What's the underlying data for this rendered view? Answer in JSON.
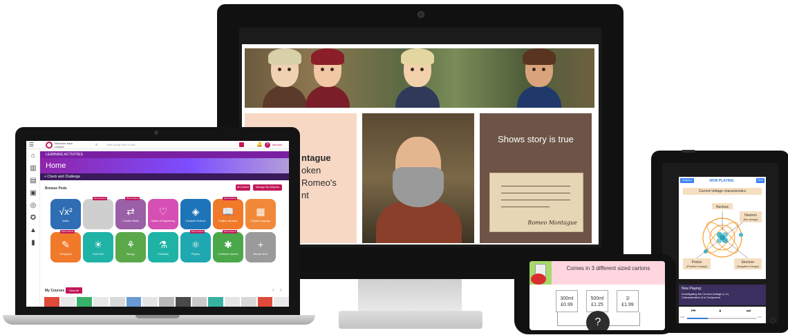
{
  "monitor": {
    "story": {
      "left_panel": {
        "name_partial": "ntague",
        "lines": [
          "oken",
          "Romeo's",
          "nt"
        ]
      },
      "right_panel": {
        "title": "Shows story is true",
        "signature": "Romeo Montague"
      }
    }
  },
  "laptop": {
    "topbar": {
      "welcome": "Welcome back",
      "welcome_sub": "Learner",
      "search_placeholder": "Start typing here to find...",
      "help": "?",
      "member": "Member"
    },
    "sidebar_icons": [
      "home-icon",
      "stats-icon",
      "notes-icon",
      "calculator-icon",
      "camera-icon",
      "award-icon",
      "grad-cap-icon",
      "chart-icon"
    ],
    "breadcrumb": "LEARNING ACTIVITIES",
    "home_title": "Home",
    "check_challenge": "+ Check and Challenge",
    "browse_pods": "Browse Pods",
    "buttons": {
      "all_content": "All Content",
      "manage_subjects": "Manage My Subjects"
    },
    "pods": [
      {
        "label": "Maths",
        "glyph": "√x²",
        "color": "#2f6db5"
      },
      {
        "label": "",
        "glyph": "",
        "color": "#cfcfcf",
        "badge": "New Content"
      },
      {
        "label": "Creative Media",
        "glyph": "⇄",
        "color": "#9b5fa8",
        "badge": "New Content"
      },
      {
        "label": "Nature of Engineering",
        "glyph": "♡",
        "color": "#d64fb4"
      },
      {
        "label": "Computer Science",
        "glyph": "◈",
        "color": "#1e74b8"
      },
      {
        "label": "English Literature",
        "glyph": "📖",
        "color": "#f07a2a",
        "badge": "New Content"
      },
      {
        "label": "English Language",
        "glyph": "▦",
        "color": "#f08a3a"
      },
      {
        "label": "Geography",
        "glyph": "✎",
        "color": "#f07a2a",
        "badge": "New Content"
      },
      {
        "label": "Food Tech",
        "glyph": "☀",
        "color": "#1fb3a6"
      },
      {
        "label": "Biology",
        "glyph": "⚘",
        "color": "#5aa84a"
      },
      {
        "label": "Chemistry",
        "glyph": "⚗",
        "color": "#1fb3a6"
      },
      {
        "label": "Physics",
        "glyph": "⚛",
        "color": "#1fa8b0",
        "badge": "New Content"
      },
      {
        "label": "Combined Science",
        "glyph": "✱",
        "color": "#4aa84a",
        "badge": "New Content"
      },
      {
        "label": "Browse More",
        "glyph": "+",
        "color": "#9a9a9a"
      }
    ],
    "my_courses": "My Courses",
    "view_all": "View All",
    "nav_arrows": "‹ ›",
    "course_colors": [
      "#e04a3a",
      "#e8e8e8",
      "#38b26a",
      "#e8e8e8",
      "#d9d9d9",
      "#6a9ad4",
      "#e4e4e4",
      "#b8b8b8",
      "#4a4a4a",
      "#c9c9c9",
      "#38b2a0",
      "#e4e4e4",
      "#d8d8d8",
      "#e04a3a",
      "#eaeaea"
    ]
  },
  "tablet": {
    "chapters": "Chapters",
    "now_playing_title": "NOW PLAYING",
    "next": "Next",
    "diagram_title": "Current-Voltage characteristics",
    "labels": {
      "nucleus": "Nucleus",
      "neutron": "Neutron",
      "neutron_charge": "[No charge]",
      "proton": "Proton",
      "proton_charge": "[Positive charge]",
      "electron": "Electron",
      "electron_charge": "[Negative charge]"
    },
    "panel": {
      "now_playing": "Now Playing:",
      "line1": "Investigating the Current-Voltage (I–V)",
      "line2": "Characteristics of a Component"
    },
    "controls": {
      "prev": "⏮",
      "pause": "⏸",
      "next": "⏭"
    },
    "progress": 0.3,
    "time_start": "0:45",
    "time_end": "3:17"
  },
  "phone": {
    "banner": "Comes in 3 different sized cartons",
    "sizes": [
      {
        "size": "300ml",
        "price": "£0.99"
      },
      {
        "size": "500ml",
        "price": "£1.25"
      },
      {
        "size": "1l",
        "price": "£1.99"
      }
    ],
    "question": "?"
  },
  "colors": {
    "brand": "#c2185b",
    "purple": "#7b1fa2"
  }
}
